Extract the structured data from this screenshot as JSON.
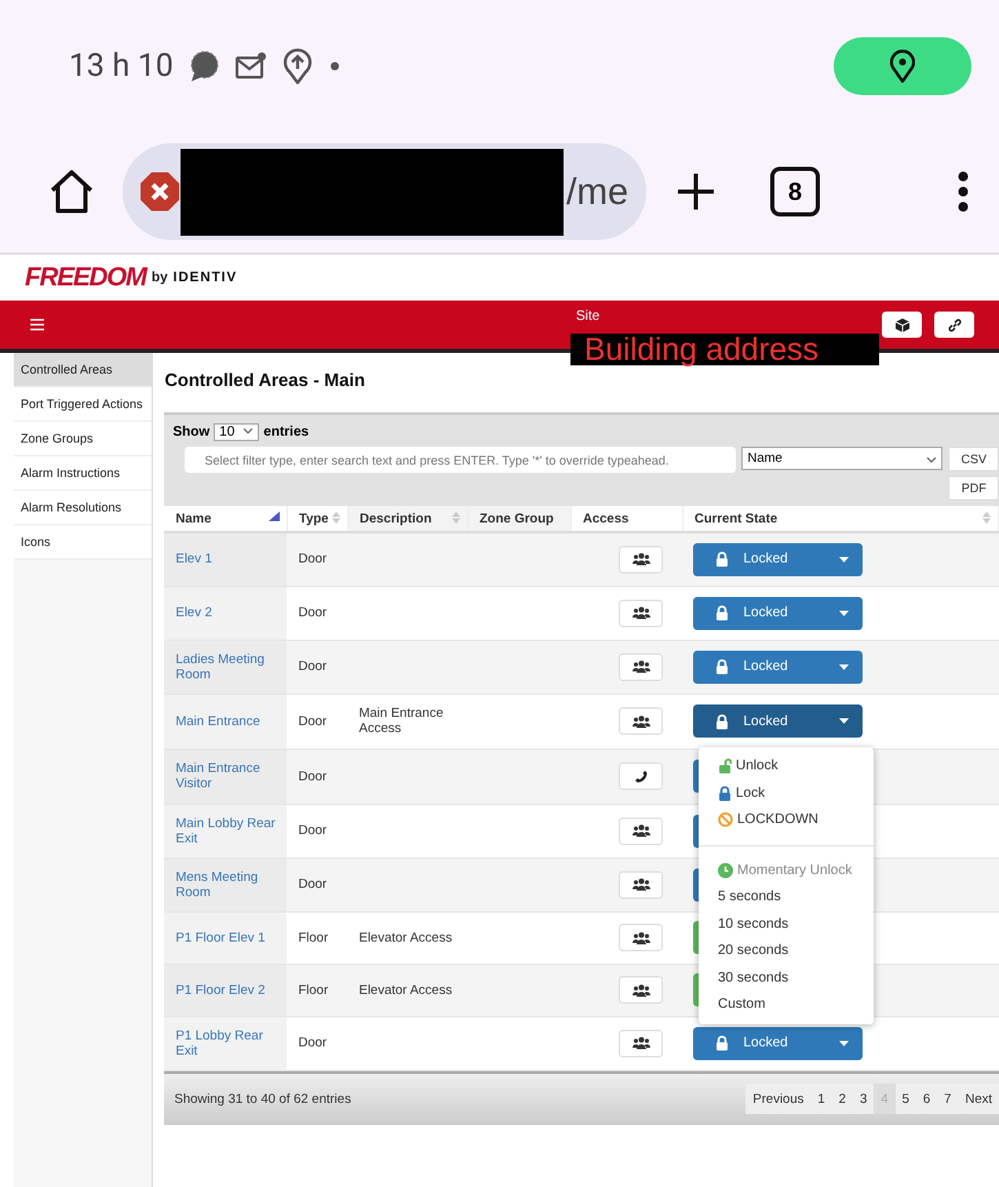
{
  "status_bar": {
    "time": "13 h 10"
  },
  "browser": {
    "url_tail": "/me",
    "tab_count": "8"
  },
  "app": {
    "logo_main": "FREEDOM",
    "logo_by": "by",
    "logo_brand": "IDENTIV",
    "site_label": "Site",
    "site_value": "Building address"
  },
  "sidebar": {
    "items": [
      {
        "label": "Controlled Areas",
        "selected": true
      },
      {
        "label": "Port Triggered Actions",
        "selected": false
      },
      {
        "label": "Zone Groups",
        "selected": false
      },
      {
        "label": "Alarm Instructions",
        "selected": false
      },
      {
        "label": "Alarm Resolutions",
        "selected": false
      },
      {
        "label": "Icons",
        "selected": false
      }
    ]
  },
  "page_title": "Controlled Areas - Main",
  "table_controls": {
    "show_label": "Show",
    "page_size": "10",
    "entries_label": "entries",
    "filter_placeholder": "Select filter type, enter search text and press ENTER. Type '*' to override typeahead.",
    "filter_type": "Name",
    "export_buttons": [
      "CSV",
      "PDF"
    ]
  },
  "table": {
    "columns": [
      "Name",
      "Type",
      "Description",
      "Zone Group",
      "Access",
      "Current State"
    ],
    "rows": [
      {
        "name": "Elev 1",
        "type": "Door",
        "description": "",
        "access": {
          "kind": "group"
        },
        "state": {
          "kind": "locked",
          "label": "Locked"
        }
      },
      {
        "name": "Elev 2",
        "type": "Door",
        "description": "",
        "access": {
          "kind": "group"
        },
        "state": {
          "kind": "locked",
          "label": "Locked"
        }
      },
      {
        "name": "Ladies Meeting Room",
        "type": "Door",
        "description": "",
        "access": {
          "kind": "group"
        },
        "state": {
          "kind": "locked",
          "label": "Locked"
        }
      },
      {
        "name": "Main Entrance",
        "type": "Door",
        "description": "Main Entrance Access",
        "access": {
          "kind": "group"
        },
        "state": {
          "kind": "locked",
          "label": "Locked",
          "open": true
        }
      },
      {
        "name": "Main Entrance Visitor",
        "type": "Door",
        "description": "",
        "access": {
          "kind": "phone"
        },
        "state": {
          "kind": "locked"
        }
      },
      {
        "name": "Main Lobby Rear Exit",
        "type": "Door",
        "description": "",
        "access": {
          "kind": "group"
        },
        "state": {
          "kind": "locked"
        }
      },
      {
        "name": "Mens Meeting Room",
        "type": "Door",
        "description": "",
        "access": {
          "kind": "group"
        },
        "state": {
          "kind": "locked"
        }
      },
      {
        "name": "P1 Floor Elev 1",
        "type": "Floor",
        "description": "Elevator Access",
        "access": {
          "kind": "group"
        },
        "state": {
          "kind": "unlocked"
        }
      },
      {
        "name": "P1 Floor Elev 2",
        "type": "Floor",
        "description": "Elevator Access",
        "access": {
          "kind": "group"
        },
        "state": {
          "kind": "unlocked"
        }
      },
      {
        "name": "P1 Lobby Rear Exit",
        "type": "Door",
        "description": "",
        "access": {
          "kind": "group"
        },
        "state": {
          "kind": "locked",
          "label": "Locked"
        }
      }
    ]
  },
  "state_menu": {
    "items": [
      {
        "kind": "unlock",
        "label": "Unlock"
      },
      {
        "kind": "lock",
        "label": "Lock"
      },
      {
        "kind": "lockdown",
        "label": "LOCKDOWN"
      },
      {
        "kind": "divider"
      },
      {
        "kind": "header",
        "label": "Momentary Unlock"
      },
      {
        "kind": "option",
        "label": "5 seconds"
      },
      {
        "kind": "option",
        "label": "10 seconds"
      },
      {
        "kind": "option",
        "label": "20 seconds"
      },
      {
        "kind": "option",
        "label": "30 seconds"
      },
      {
        "kind": "option",
        "label": "Custom"
      }
    ]
  },
  "footer": {
    "info": "Showing 31 to 40 of 62 entries",
    "pagination": [
      {
        "label": "Previous",
        "selected": false
      },
      {
        "label": "1",
        "selected": false
      },
      {
        "label": "2",
        "selected": false
      },
      {
        "label": "3",
        "selected": false
      },
      {
        "label": "4",
        "selected": true
      },
      {
        "label": "5",
        "selected": false
      },
      {
        "label": "6",
        "selected": false
      },
      {
        "label": "7",
        "selected": false
      },
      {
        "label": "Next",
        "selected": false
      }
    ]
  }
}
